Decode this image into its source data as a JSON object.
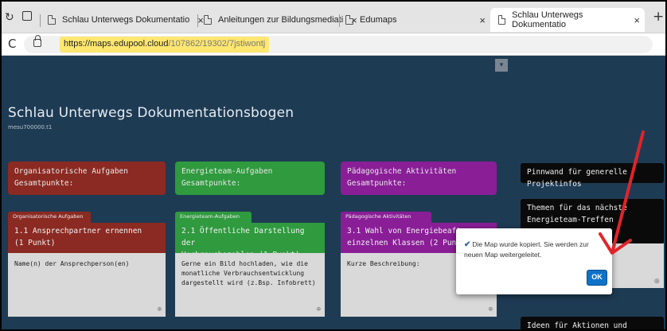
{
  "browser": {
    "tabs": [
      {
        "title": "Schlau Unterwegs Dokumentatio",
        "close": "×",
        "active": false
      },
      {
        "title": "Anleitungen zur Bildungsmediati",
        "close": "×",
        "active": false
      },
      {
        "title": "Edumaps",
        "close": "×",
        "active": false
      },
      {
        "title": "Schlau Unterwegs Dokumentatio",
        "close": "×",
        "active": true
      }
    ],
    "new_tab": "+",
    "url_domain": "https://maps.edupool.cloud",
    "url_path": "/107862/19302/7jstiwontj"
  },
  "map": {
    "title": "Schlau Unterwegs Dokumentationsbogen",
    "subtitle": "mesu700000.t1"
  },
  "columns": [
    {
      "header": "Organisatorische Aufgaben\nGesamtpunkte:",
      "tag": "Organisatorische Aufgaben",
      "task_title": "1.1 Ansprechpartner ernennen\n(1 Punkt)",
      "task_body": "Name(n) der Ansprechperson(en)"
    },
    {
      "header": "Energieteam-Aufgaben\nGesamtpunkte:",
      "tag": "Energieteam-Aufgaben",
      "task_title": "2.1 Öffentliche Darstellung der\nVerbrauchszahlen (1 Punkt)",
      "task_body": "Gerne ein Bild hochladen, wie die monatliche Verbrauchsentwicklung dargestellt wird (z.Bsp. Infobrett)"
    },
    {
      "header": "Pädagogische Aktivitäten\nGesamtpunkte:",
      "tag": "Pädagogische Aktivitäten",
      "task_title": "3.1 Wahl von Energiebeaftrag\neinzelnen Klassen (2 Punkte)",
      "task_body": "Kurze Beschreibung:"
    }
  ],
  "right_cards": {
    "pinnwand": "Pinnwand für generelle Projektinfos",
    "themen": "Themen für das nächste Energieteam-Treffen",
    "ideen": "Ideen für Aktionen und Maßnahmen"
  },
  "dialog": {
    "check": "✔",
    "message": "Die Map wurde kopiert. Sie werden zur neuen Map weitergeleitet.",
    "ok": "OK"
  },
  "icons": {
    "zoom": "⊕",
    "dropdown": "▾",
    "reload": "C"
  },
  "colors": {
    "organisatorisch": "#8b2a22",
    "energieteam": "#2f9a3e",
    "paedagogisch": "#8a1e97",
    "pinnwand": "#0a0a0a",
    "annotation_arrow": "#e0242a",
    "url_highlight": "#ffe770"
  }
}
